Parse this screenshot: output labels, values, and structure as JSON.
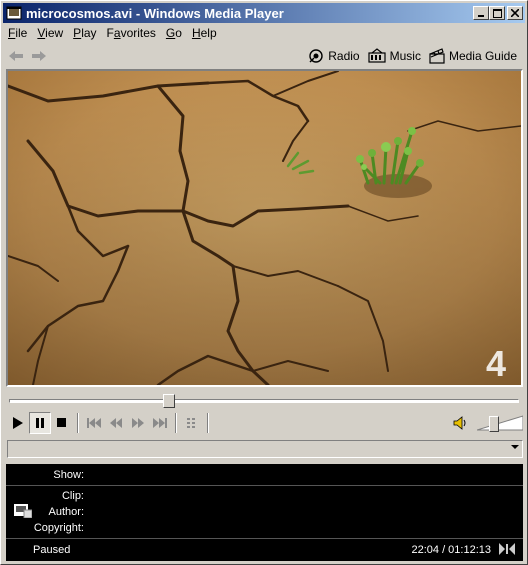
{
  "window": {
    "title": "microcosmos.avi - Windows Media Player"
  },
  "menu": [
    {
      "label": "File",
      "key": "F"
    },
    {
      "label": "View",
      "key": "V"
    },
    {
      "label": "Play",
      "key": "P"
    },
    {
      "label": "Favorites",
      "key": "a"
    },
    {
      "label": "Go",
      "key": "G"
    },
    {
      "label": "Help",
      "key": "H"
    }
  ],
  "nav": {
    "radio": "Radio",
    "music": "Music",
    "media_guide": "Media Guide"
  },
  "video": {
    "watermark": "4"
  },
  "seek": {
    "position_fraction": 0.31
  },
  "volume": {
    "level_fraction": 0.33
  },
  "info": {
    "show_label": "Show:",
    "clip_label": "Clip:",
    "author_label": "Author:",
    "copyright_label": "Copyright:",
    "status": "Paused",
    "time": "22:04 / 01:12:13"
  },
  "colors": {
    "title_active": "#0a246a",
    "face": "#d4d0c8",
    "panel": "#000000"
  }
}
